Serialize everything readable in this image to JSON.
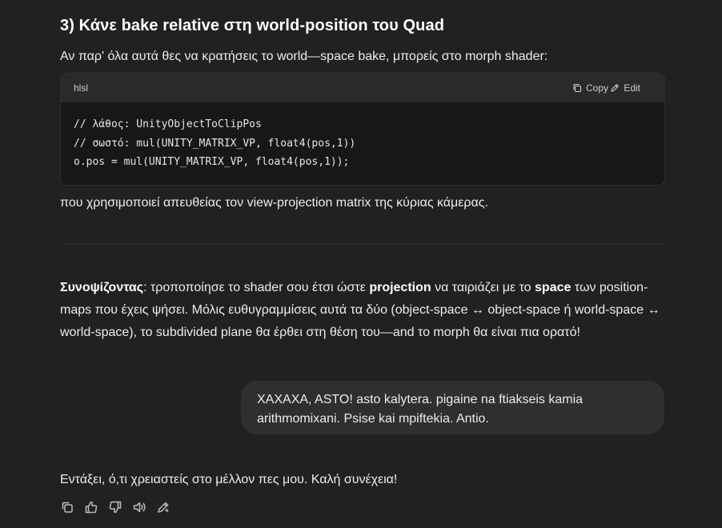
{
  "heading": {
    "prefix": "3) Κάνε bake ",
    "bold": "relative",
    "suffix": " στη world-position του Quad"
  },
  "intro_text": "Αν παρ' όλα αυτά θες να κρατήσεις το world—space bake, μπορείς στο morph shader:",
  "code_block": {
    "language": "hlsl",
    "copy_label": "Copy",
    "edit_label": "Edit",
    "lines": [
      "// λάθος: UnityObjectToClipPos",
      "// σωστό: mul(UNITY_MATRIX_VP, float4(pos,1))",
      "o.pos = mul(UNITY_MATRIX_VP, float4(pos,1));"
    ]
  },
  "after_code_text": "που χρησιμοποιεί απευθείας τον view-projection matrix της κύριας κάμερας.",
  "summary": {
    "lead": "Συνοψίζοντας",
    "part1": ": τροποποίησε το shader σου έτσι ώστε ",
    "bold1": "projection",
    "part2": " να ταιριάζει με το ",
    "bold2": "space",
    "part3": " των position-maps που έχεις ψήσει. Μόλις ευθυγραμμίσεις αυτά τα δύο (object-space ↔ object-space ή world-space ↔ world-space), το subdivided plane θα έρθει στη θέση του—and το morph θα είναι πια ορατό!"
  },
  "user_message": "XAXAXA, ASTO!  asto kalytera. pigaine na ftiakseis kamia arithmomixani. Psise kai mpiftekia. Antio.",
  "assistant_reply": "Εντάξει, ό,τι χρειαστείς στο μέλλον πες μου. Καλή συνέχεια!",
  "action_icons": [
    "copy-icon",
    "thumbs-up-icon",
    "thumbs-down-icon",
    "speaker-icon",
    "edit-icon"
  ]
}
